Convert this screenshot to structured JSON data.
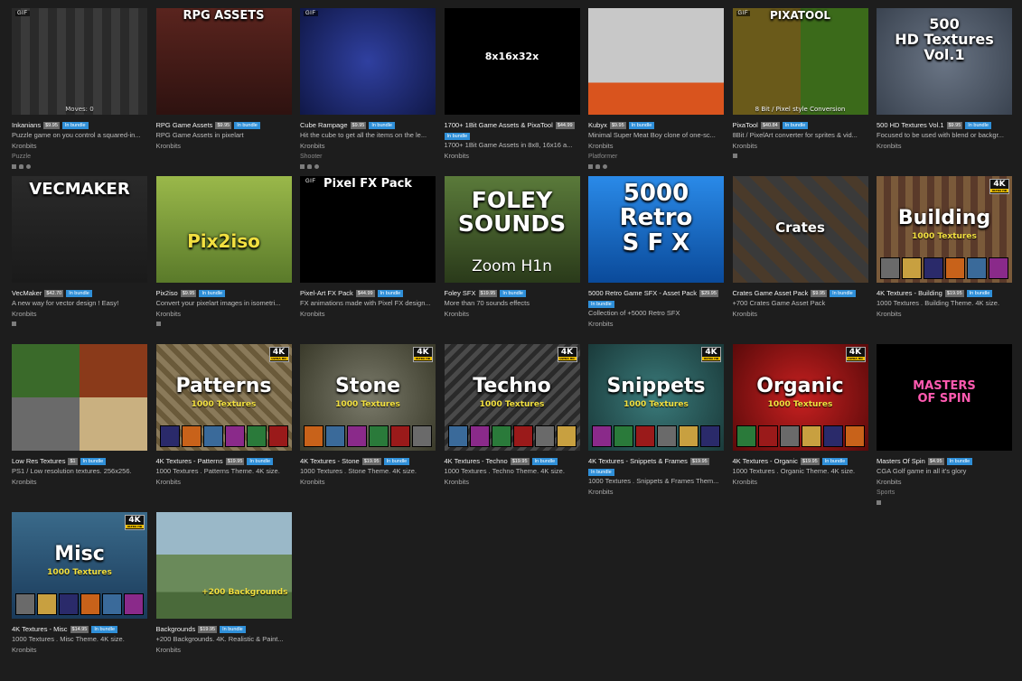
{
  "colors": {
    "page_bg": "#1d1d1d",
    "bundle_badge": "#2f8fd8",
    "price_badge": "#6a6a6a"
  },
  "items": [
    {
      "key": "inkanians",
      "title": "Inkanians",
      "price": "$9.95",
      "bundle": "In bundle",
      "desc": "Puzzle game on you control a squared-in...",
      "author": "Kronbits",
      "genre": "Puzzle",
      "platforms": [
        "windows",
        "linux",
        "mac"
      ],
      "thumb": {
        "bg": "#222",
        "text": "",
        "sub": "",
        "gif": true,
        "k4": false,
        "caption": "Moves: 0"
      }
    },
    {
      "key": "rpg-game-assets",
      "title": "RPG Game Assets",
      "price": "$9.95",
      "bundle": "In bundle",
      "desc": "RPG Game Assets in pixelart",
      "author": "Kronbits",
      "genre": "",
      "platforms": [],
      "thumb": {
        "bg": "#4a1f1a",
        "text": "RPG ASSETS",
        "sub": "",
        "gif": false,
        "k4": false,
        "caption": ""
      }
    },
    {
      "key": "cube-rampage",
      "title": "Cube Rampage",
      "price": "$9.95",
      "bundle": "In bundle",
      "desc": "Hit the cube to get all the items on the le...",
      "author": "Kronbits",
      "genre": "Shooter",
      "platforms": [
        "windows",
        "linux",
        "mac"
      ],
      "thumb": {
        "bg": "#1a2a6a",
        "text": "",
        "sub": "",
        "gif": true,
        "k4": false,
        "caption": ""
      }
    },
    {
      "key": "1bit-game-assets",
      "title": "1700+ 1Bit Game Assets & PixaTool",
      "price": "$44.99",
      "bundle": "In bundle",
      "desc": "1700+ 1Bit Game Assets in 8x8, 16x16 a...",
      "author": "Kronbits",
      "genre": "",
      "platforms": [],
      "thumb": {
        "bg": "#000",
        "text": "8x16x32x",
        "sub": "",
        "gif": false,
        "k4": false,
        "caption": ""
      }
    },
    {
      "key": "kubyx",
      "title": "Kubyx",
      "price": "$9.95",
      "bundle": "In bundle",
      "desc": "Minimal Super Meat Boy clone of one-sc...",
      "author": "Kronbits",
      "genre": "Platformer",
      "platforms": [
        "windows",
        "linux",
        "mac"
      ],
      "thumb": {
        "bg": "#c8c8c8",
        "text": "",
        "sub": "",
        "gif": false,
        "k4": false,
        "caption": ""
      }
    },
    {
      "key": "pixatool",
      "title": "PixaTool",
      "price": "$40.84",
      "bundle": "In bundle",
      "desc": "8Bit / PixelArt converter for sprites & vid...",
      "author": "Kronbits",
      "genre": "",
      "platforms": [
        "windows"
      ],
      "thumb": {
        "bg": "#3b5a1a",
        "text": "PIXATOOL",
        "sub": "8 Bit / Pixel style Conversion",
        "gif": true,
        "k4": false,
        "caption": ""
      }
    },
    {
      "key": "500-hd-textures",
      "title": "500 HD Textures Vol.1",
      "price": "$9.95",
      "bundle": "In bundle",
      "desc": "Focused to be used with blend or backgr...",
      "author": "Kronbits",
      "genre": "",
      "platforms": [],
      "thumb": {
        "bg": "#4a5563",
        "text": "500\nHD Textures\nVol.1",
        "sub": "",
        "gif": false,
        "k4": false,
        "caption": ""
      }
    },
    {
      "key": "vecmaker",
      "title": "VecMaker",
      "price": "$42.70",
      "bundle": "In bundle",
      "desc": "A new way for vector design ! Easy!",
      "author": "Kronbits",
      "genre": "",
      "platforms": [
        "windows"
      ],
      "thumb": {
        "bg": "#2a2a2a",
        "text": "VECMAKER",
        "sub": "",
        "gif": false,
        "k4": false,
        "caption": ""
      }
    },
    {
      "key": "pix2iso",
      "title": "Pix2iso",
      "price": "$9.95",
      "bundle": "In bundle",
      "desc": "Convert your pixelart images in isometri...",
      "author": "Kronbits",
      "genre": "",
      "platforms": [
        "windows"
      ],
      "thumb": {
        "bg": "#7a9a3a",
        "text": "Pix2iso",
        "sub": "",
        "gif": false,
        "k4": false,
        "caption": ""
      }
    },
    {
      "key": "pixel-art-fx-pack",
      "title": "Pixel-Art FX Pack",
      "price": "$44.99",
      "bundle": "In bundle",
      "desc": "FX animations made with Pixel FX design...",
      "author": "Kronbits",
      "genre": "",
      "platforms": [],
      "thumb": {
        "bg": "#000",
        "text": "Pixel FX Pack",
        "sub": "",
        "gif": true,
        "k4": false,
        "caption": ""
      }
    },
    {
      "key": "foley-sfx",
      "title": "Foley SFX",
      "price": "$19.95",
      "bundle": "In bundle",
      "desc": "More than 70 sounds effects",
      "author": "Kronbits",
      "genre": "",
      "platforms": [],
      "thumb": {
        "bg": "#4a6a2a",
        "text": "FOLEY\nSOUNDS",
        "sub": "Zoom H1n",
        "gif": false,
        "k4": false,
        "caption": ""
      }
    },
    {
      "key": "5000-retro-sfx",
      "title": "5000 Retro Game SFX - Asset Pack",
      "price": "$29.95",
      "bundle": "In bundle",
      "desc": "Collection of +5000 Retro SFX",
      "author": "Kronbits",
      "genre": "",
      "platforms": [],
      "thumb": {
        "bg": "#1e7ad8",
        "text": "5000\nRetro\nS F X",
        "sub": "",
        "gif": false,
        "k4": false,
        "caption": ""
      }
    },
    {
      "key": "crates-asset-pack",
      "title": "Crates Game Asset Pack",
      "price": "$9.95",
      "bundle": "In bundle",
      "desc": "+700 Crates Game Asset Pack",
      "author": "Kronbits",
      "genre": "",
      "platforms": [],
      "thumb": {
        "bg": "#3a3a3a",
        "text": "Crates",
        "sub": "",
        "gif": false,
        "k4": false,
        "caption": ""
      }
    },
    {
      "key": "4k-building",
      "title": "4K Textures - Building",
      "price": "$19.95",
      "bundle": "In bundle",
      "desc": "1000 Textures . Building Theme. 4K size.",
      "author": "Kronbits",
      "genre": "",
      "platforms": [],
      "thumb": {
        "bg": "#6a4a2a",
        "text": "Building",
        "sub": "1000 Textures",
        "gif": false,
        "k4": true,
        "caption": ""
      }
    },
    {
      "key": "low-res-textures",
      "title": "Low Res Textures",
      "price": "$1",
      "bundle": "In bundle",
      "desc": "PS1 / Low resolution textures. 256x256.",
      "author": "Kronbits",
      "genre": "",
      "platforms": [],
      "thumb": {
        "bg": "#5a3a2a",
        "text": "",
        "sub": "",
        "gif": false,
        "k4": false,
        "caption": ""
      }
    },
    {
      "key": "4k-patterns",
      "title": "4K Textures - Patterns",
      "price": "$19.95",
      "bundle": "In bundle",
      "desc": "1000 Textures . Patterns Theme. 4K size.",
      "author": "Kronbits",
      "genre": "",
      "platforms": [],
      "thumb": {
        "bg": "#7a6a4a",
        "text": "Patterns",
        "sub": "1000 Textures",
        "gif": false,
        "k4": true,
        "caption": ""
      }
    },
    {
      "key": "4k-stone",
      "title": "4K Textures - Stone",
      "price": "$19.95",
      "bundle": "In bundle",
      "desc": "1000 Textures . Stone Theme. 4K size.",
      "author": "Kronbits",
      "genre": "",
      "platforms": [],
      "thumb": {
        "bg": "#5a5a4a",
        "text": "Stone",
        "sub": "1000 Textures",
        "gif": false,
        "k4": true,
        "caption": ""
      }
    },
    {
      "key": "4k-techno",
      "title": "4K Textures - Techno",
      "price": "$19.95",
      "bundle": "In bundle",
      "desc": "1000 Textures . Techno Theme. 4K size.",
      "author": "Kronbits",
      "genre": "",
      "platforms": [],
      "thumb": {
        "bg": "#3a3a3a",
        "text": "Techno",
        "sub": "1000 Textures",
        "gif": false,
        "k4": true,
        "caption": ""
      }
    },
    {
      "key": "4k-snippets",
      "title": "4K Textures - Snippets & Frames",
      "price": "$19.95",
      "bundle": "In bundle",
      "desc": "1000 Textures . Snippets & Frames Them...",
      "author": "Kronbits",
      "genre": "",
      "platforms": [],
      "thumb": {
        "bg": "#2a5a5a",
        "text": "Snippets",
        "sub": "1000 Textures",
        "gif": false,
        "k4": true,
        "caption": ""
      }
    },
    {
      "key": "4k-organic",
      "title": "4K Textures - Organic",
      "price": "$19.95",
      "bundle": "In bundle",
      "desc": "1000 Textures . Organic Theme. 4K size.",
      "author": "Kronbits",
      "genre": "",
      "platforms": [],
      "thumb": {
        "bg": "#9a1a1a",
        "text": "Organic",
        "sub": "1000 Textures",
        "gif": false,
        "k4": true,
        "caption": ""
      }
    },
    {
      "key": "masters-of-spin",
      "title": "Masters Of Spin",
      "price": "$4.95",
      "bundle": "In bundle",
      "desc": "CGA Golf game in all it's glory",
      "author": "Kronbits",
      "genre": "Sports",
      "platforms": [
        "windows"
      ],
      "thumb": {
        "bg": "#000",
        "text": "MASTERS\nOF SPIN",
        "sub": "",
        "gif": false,
        "k4": false,
        "caption": ""
      }
    },
    {
      "key": "4k-misc",
      "title": "4K Textures - Misc",
      "price": "$14.95",
      "bundle": "In bundle",
      "desc": "1000 Textures . Misc Theme. 4K size.",
      "author": "Kronbits",
      "genre": "",
      "platforms": [],
      "thumb": {
        "bg": "#2a4a6a",
        "text": "Misc",
        "sub": "1000 Textures",
        "gif": false,
        "k4": true,
        "caption": ""
      }
    },
    {
      "key": "backgrounds",
      "title": "Backgrounds",
      "price": "$19.95",
      "bundle": "In bundle",
      "desc": "+200 Backgrounds. 4K. Realistic & Paint...",
      "author": "Kronbits",
      "genre": "",
      "platforms": [],
      "thumb": {
        "bg": "#5a7a8a",
        "text": "",
        "sub": "+200 Backgrounds",
        "gif": false,
        "k4": false,
        "caption": ""
      }
    }
  ]
}
